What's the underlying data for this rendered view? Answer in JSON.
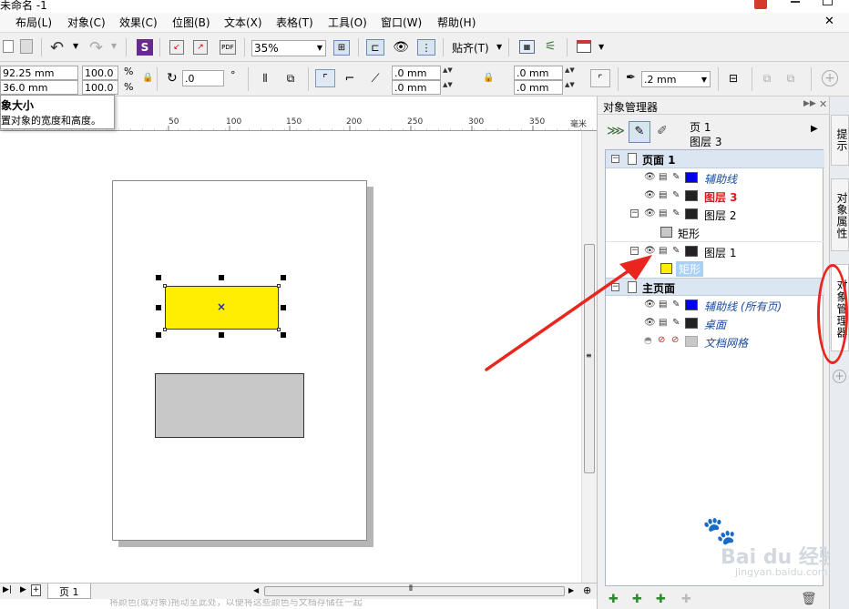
{
  "window": {
    "title": "未命名 -1"
  },
  "menu": [
    "布局(L)",
    "对象(C)",
    "效果(C)",
    "位图(B)",
    "文本(X)",
    "表格(T)",
    "工具(O)",
    "窗口(W)",
    "帮助(H)"
  ],
  "toolbar": {
    "zoom": "35%",
    "snap_label": "贴齐(T)"
  },
  "property_bar": {
    "width": "92.25 mm",
    "height": "36.0 mm",
    "scale_x": "100.0",
    "scale_y": "100.0",
    "percent": "%",
    "rotation": ".0",
    "degree": "°",
    "corner_1": ".0 mm",
    "corner_2": ".0 mm",
    "corner_3": ".0 mm",
    "corner_4": ".0 mm",
    "outline": ".2 mm"
  },
  "tooltip": {
    "title": "象大小",
    "text": "置对象的宽度和高度。"
  },
  "ruler": {
    "ticks": [
      "50",
      "100",
      "150",
      "200",
      "250",
      "300",
      "350"
    ],
    "unit": "毫米"
  },
  "status": {
    "page_tab": "页 1",
    "hint": "将颜色(或对象)拖动至此处，以便将这些颜色与文档存储在一起"
  },
  "docker": {
    "title": "对象管理器",
    "current_page": "页 1",
    "current_layer": "图层 3",
    "tree": [
      {
        "label": "页面 1",
        "kind": "page"
      },
      {
        "label": "辅助线",
        "kind": "layer",
        "color": "#0000ee",
        "style": "guide"
      },
      {
        "label": "图层 3",
        "kind": "layer",
        "color": "#222222",
        "style": "active"
      },
      {
        "label": "图层 2",
        "kind": "layer",
        "color": "#222222",
        "style": "normal"
      },
      {
        "label": "矩形",
        "kind": "object",
        "color": "#c8c8c8",
        "style": "normal"
      },
      {
        "label": "图层 1",
        "kind": "layer",
        "color": "#222222",
        "style": "normal"
      },
      {
        "label": "矩形",
        "kind": "object",
        "color": "#ffee00",
        "style": "selected"
      },
      {
        "label": "主页面",
        "kind": "page"
      },
      {
        "label": "辅助线 (所有页)",
        "kind": "layer",
        "color": "#0000ee",
        "style": "guide"
      },
      {
        "label": "桌面",
        "kind": "layer",
        "color": "#222222",
        "style": "guide"
      },
      {
        "label": "文档网格",
        "kind": "layer",
        "color": "#c8c8c8",
        "style": "guide"
      }
    ]
  },
  "side_tabs": [
    "提示",
    "对象属性",
    "对象管理器"
  ],
  "watermark": {
    "brand": "Bai du 经验",
    "url": "jingyan.baidu.com"
  },
  "colors": {
    "selected_rect": "#ffee00",
    "gray_rect": "#c8c8c8",
    "annotation": "#e8261e",
    "highlight": "#aad0f5"
  }
}
